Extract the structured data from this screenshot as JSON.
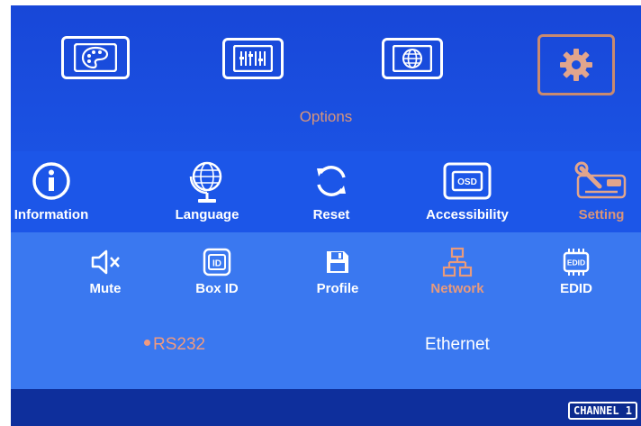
{
  "top_menu": {
    "tiles": [
      {
        "icon": "palette-icon"
      },
      {
        "icon": "equalizer-icon"
      },
      {
        "icon": "globe-icon"
      },
      {
        "icon": "gear-icon",
        "active": true
      }
    ],
    "title": "Options"
  },
  "options_menu": {
    "items": [
      {
        "label": "Information",
        "icon": "info-icon"
      },
      {
        "label": "Language",
        "icon": "globe-stand-icon"
      },
      {
        "label": "Reset",
        "icon": "refresh-icon"
      },
      {
        "label": "Accessibility",
        "icon": "osd-icon"
      },
      {
        "label": "Setting",
        "icon": "wrench-tool-icon",
        "active": true
      }
    ]
  },
  "setting_menu": {
    "items": [
      {
        "label": "Mute",
        "icon": "speaker-mute-icon"
      },
      {
        "label": "Box ID",
        "icon": "id-icon"
      },
      {
        "label": "Profile",
        "icon": "floppy-icon"
      },
      {
        "label": "Network",
        "icon": "network-icon",
        "active": true
      },
      {
        "label": "EDID",
        "icon": "edid-chip-icon"
      }
    ]
  },
  "network_options": {
    "rs232": "RS232",
    "ethernet": "Ethernet",
    "selected": "RS232"
  },
  "status_bar": {
    "channel": "CHANNEL 1"
  },
  "colors": {
    "accent": "#d9957a",
    "background": "#1a4fe0"
  }
}
